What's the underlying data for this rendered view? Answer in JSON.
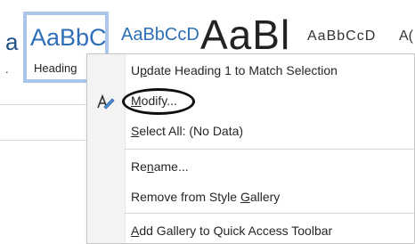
{
  "gallery": {
    "tiles": [
      {
        "preview": "a",
        "name": "."
      },
      {
        "preview": "AaBbC(",
        "name": "Heading"
      },
      {
        "preview": "AaBbCcD",
        "name": ""
      },
      {
        "preview": "AaBl",
        "name": ""
      },
      {
        "preview": "AaBbCcD",
        "name": ""
      },
      {
        "preview": "A(",
        "name": ""
      }
    ]
  },
  "context_menu": {
    "items": [
      {
        "prefix": "U",
        "underline": "p",
        "suffix": "date Heading 1 to Match Selection"
      },
      {
        "prefix": "",
        "underline": "M",
        "suffix": "odify..."
      },
      {
        "prefix": "",
        "underline": "S",
        "suffix": "elect All: (No Data)"
      },
      {
        "prefix": "Re",
        "underline": "n",
        "suffix": "ame..."
      },
      {
        "prefix": "Remove from Style ",
        "underline": "G",
        "suffix": "allery"
      },
      {
        "prefix": "",
        "underline": "A",
        "suffix": "dd Gallery to Quick Access Toolbar"
      }
    ],
    "modify_icon": "pencil-a-icon",
    "highlighted_item": "Modify..."
  },
  "colors": {
    "heading_blue": "#2e6fb8",
    "selection_border": "#a9c6ea",
    "menu_gutter": "#f3f3f3"
  }
}
